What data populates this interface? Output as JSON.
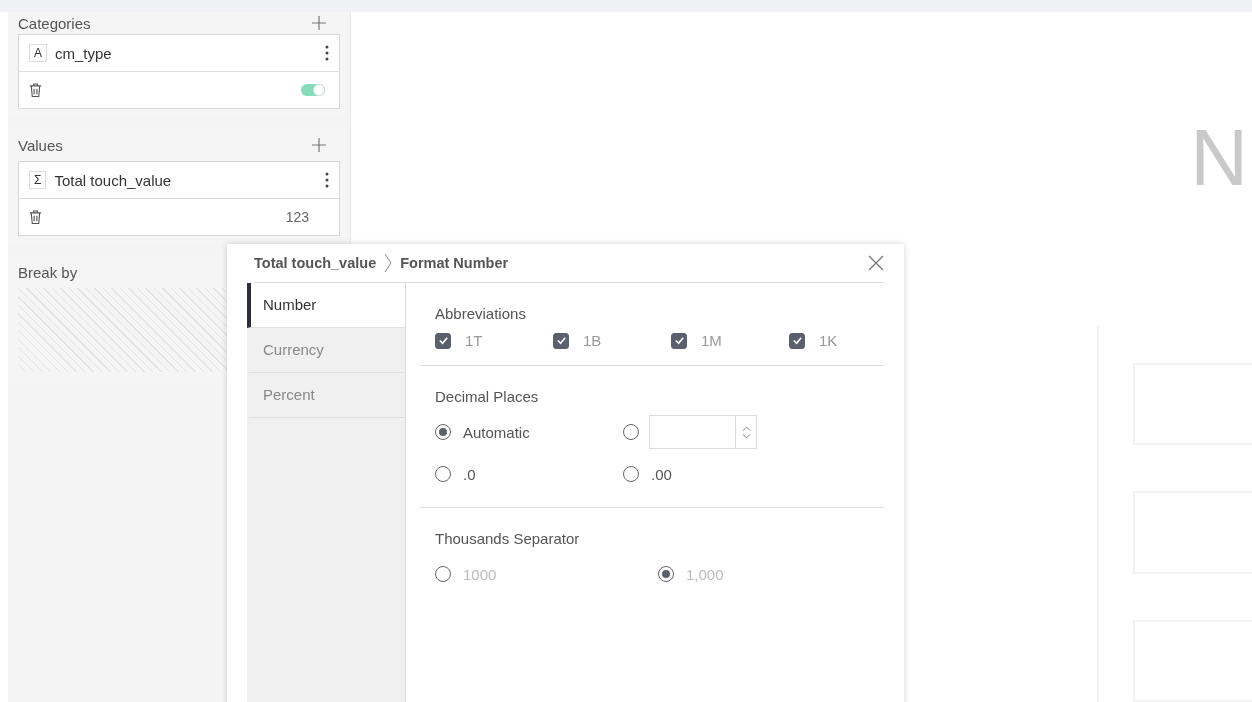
{
  "sidebar": {
    "sections": [
      {
        "title": "Categories",
        "fields": [
          {
            "type_icon": "A",
            "name": "cm_type",
            "toggle": {
              "on": true
            }
          }
        ]
      },
      {
        "title": "Values",
        "fields": [
          {
            "type_icon": "Σ",
            "name": "Total touch_value",
            "format": "123"
          }
        ]
      },
      {
        "title": "Break by"
      }
    ]
  },
  "canvas": {
    "heading": "N"
  },
  "dialog": {
    "breadcrumb": [
      "Total touch_value",
      "Format Number"
    ],
    "tabs": [
      {
        "label": "Number",
        "selected": true
      },
      {
        "label": "Currency",
        "selected": false
      },
      {
        "label": "Percent",
        "selected": false
      }
    ],
    "abbreviations": {
      "title": "Abbreviations",
      "options": [
        {
          "label": "1T",
          "checked": true
        },
        {
          "label": "1B",
          "checked": true
        },
        {
          "label": "1M",
          "checked": true
        },
        {
          "label": "1K",
          "checked": true
        }
      ]
    },
    "decimal_places": {
      "title": "Decimal Places",
      "options": [
        {
          "kind": "label",
          "label": "Automatic",
          "selected": true
        },
        {
          "kind": "spinner",
          "selected": false
        },
        {
          "kind": "label",
          "label": ".0",
          "selected": false
        },
        {
          "kind": "label",
          "label": ".00",
          "selected": false
        }
      ]
    },
    "thousands_separator": {
      "title": "Thousands Separator",
      "disabled": true,
      "options": [
        {
          "label": "1000",
          "selected": false
        },
        {
          "label": "1,000",
          "selected": true
        }
      ]
    }
  }
}
